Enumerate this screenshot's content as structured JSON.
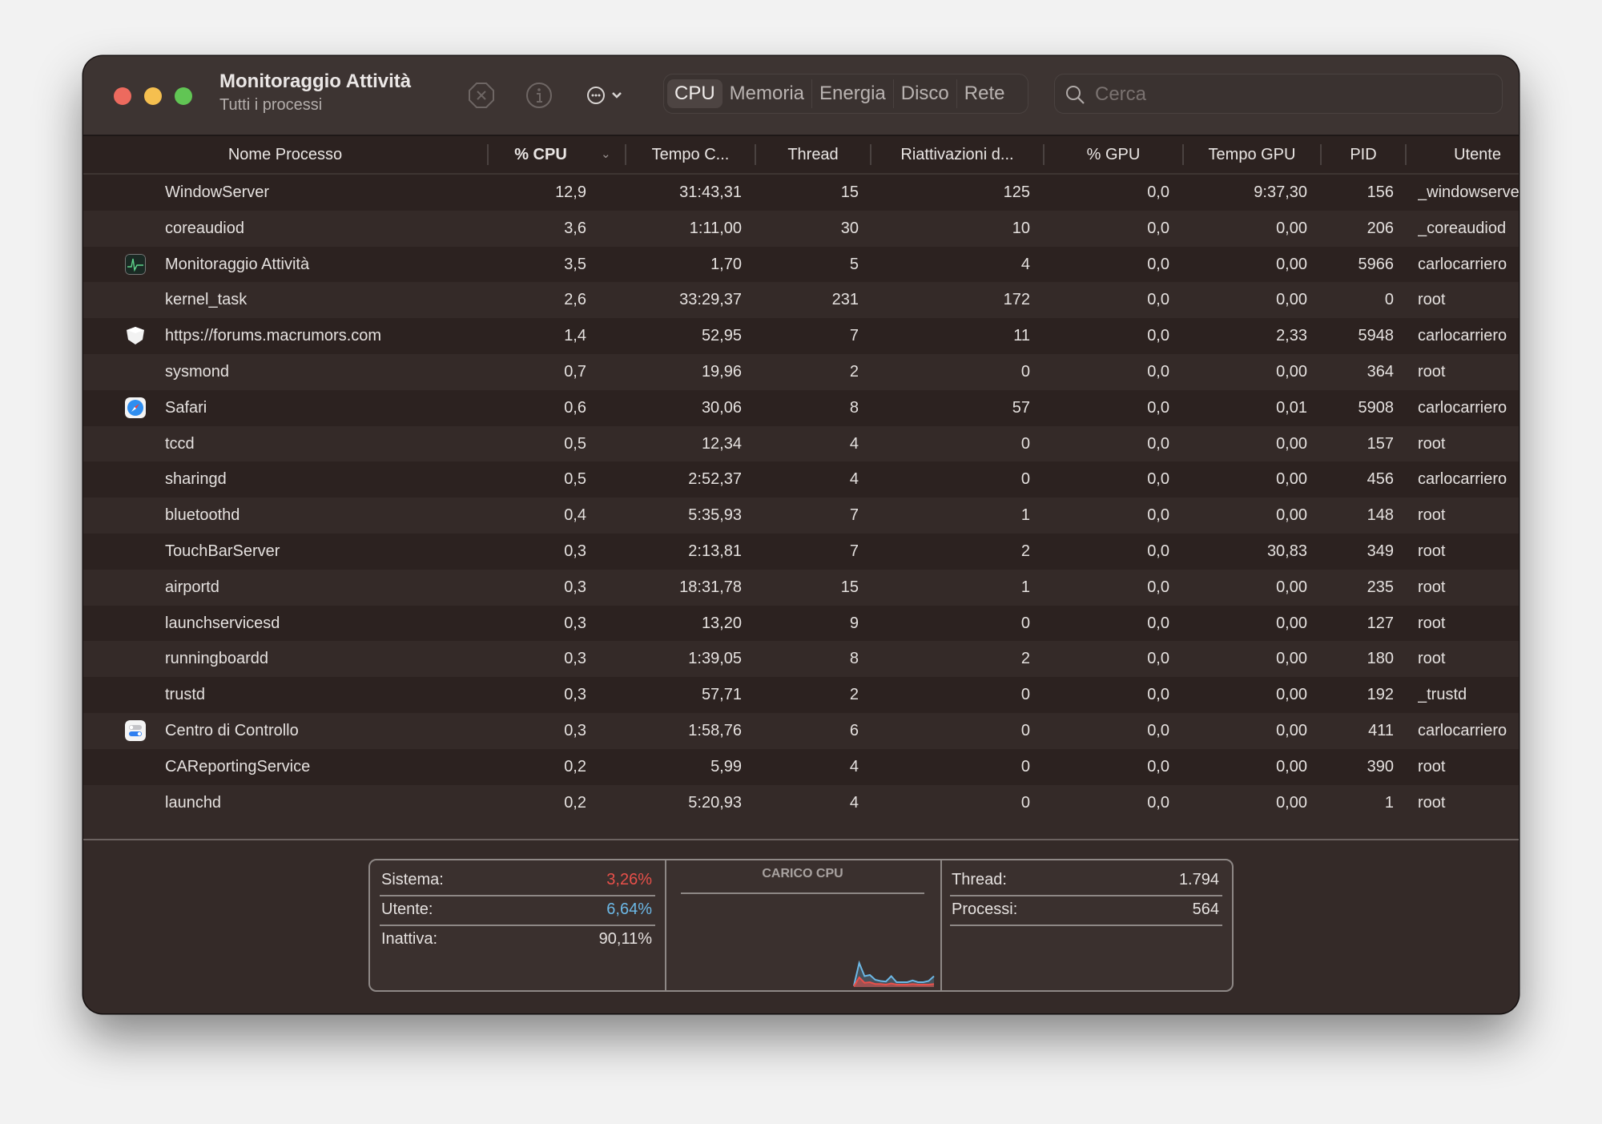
{
  "window": {
    "title": "Monitoraggio Attività",
    "subtitle": "Tutti i processi"
  },
  "toolbar": {
    "stop_icon": "stop-process-icon",
    "info_icon": "info-icon",
    "more_icon": "ellipsis-circle-icon",
    "tabs": [
      {
        "label": "CPU",
        "active": true
      },
      {
        "label": "Memoria",
        "active": false
      },
      {
        "label": "Energia",
        "active": false
      },
      {
        "label": "Disco",
        "active": false
      },
      {
        "label": "Rete",
        "active": false
      }
    ],
    "search": {
      "placeholder": "Cerca",
      "value": ""
    }
  },
  "table": {
    "columns": [
      "Nome Processo",
      "% CPU",
      "Tempo C...",
      "Thread",
      "Riattivazioni d...",
      "% GPU",
      "Tempo GPU",
      "PID",
      "Utente"
    ],
    "sorted_column": "% CPU",
    "rows": [
      {
        "icon": "",
        "name": "WindowServer",
        "cpu": "12,9",
        "cpu_time": "31:43,31",
        "threads": "15",
        "wakeups": "125",
        "gpu": "0,0",
        "gpu_time": "9:37,30",
        "pid": "156",
        "user": "_windowserver"
      },
      {
        "icon": "",
        "name": "coreaudiod",
        "cpu": "3,6",
        "cpu_time": "1:11,00",
        "threads": "30",
        "wakeups": "10",
        "gpu": "0,0",
        "gpu_time": "0,00",
        "pid": "206",
        "user": "_coreaudiod"
      },
      {
        "icon": "activity-monitor-icon",
        "name": "Monitoraggio Attività",
        "cpu": "3,5",
        "cpu_time": "1,70",
        "threads": "5",
        "wakeups": "4",
        "gpu": "0,0",
        "gpu_time": "0,00",
        "pid": "5966",
        "user": "carlocarriero"
      },
      {
        "icon": "",
        "name": "kernel_task",
        "cpu": "2,6",
        "cpu_time": "33:29,37",
        "threads": "231",
        "wakeups": "172",
        "gpu": "0,0",
        "gpu_time": "0,00",
        "pid": "0",
        "user": "root"
      },
      {
        "icon": "web-content-shield-icon",
        "name": "https://forums.macrumors.com",
        "cpu": "1,4",
        "cpu_time": "52,95",
        "threads": "7",
        "wakeups": "11",
        "gpu": "0,0",
        "gpu_time": "2,33",
        "pid": "5948",
        "user": "carlocarriero"
      },
      {
        "icon": "",
        "name": "sysmond",
        "cpu": "0,7",
        "cpu_time": "19,96",
        "threads": "2",
        "wakeups": "0",
        "gpu": "0,0",
        "gpu_time": "0,00",
        "pid": "364",
        "user": "root"
      },
      {
        "icon": "safari-icon",
        "name": "Safari",
        "cpu": "0,6",
        "cpu_time": "30,06",
        "threads": "8",
        "wakeups": "57",
        "gpu": "0,0",
        "gpu_time": "0,01",
        "pid": "5908",
        "user": "carlocarriero"
      },
      {
        "icon": "",
        "name": "tccd",
        "cpu": "0,5",
        "cpu_time": "12,34",
        "threads": "4",
        "wakeups": "0",
        "gpu": "0,0",
        "gpu_time": "0,00",
        "pid": "157",
        "user": "root"
      },
      {
        "icon": "",
        "name": "sharingd",
        "cpu": "0,5",
        "cpu_time": "2:52,37",
        "threads": "4",
        "wakeups": "0",
        "gpu": "0,0",
        "gpu_time": "0,00",
        "pid": "456",
        "user": "carlocarriero"
      },
      {
        "icon": "",
        "name": "bluetoothd",
        "cpu": "0,4",
        "cpu_time": "5:35,93",
        "threads": "7",
        "wakeups": "1",
        "gpu": "0,0",
        "gpu_time": "0,00",
        "pid": "148",
        "user": "root"
      },
      {
        "icon": "",
        "name": "TouchBarServer",
        "cpu": "0,3",
        "cpu_time": "2:13,81",
        "threads": "7",
        "wakeups": "2",
        "gpu": "0,0",
        "gpu_time": "30,83",
        "pid": "349",
        "user": "root"
      },
      {
        "icon": "",
        "name": "airportd",
        "cpu": "0,3",
        "cpu_time": "18:31,78",
        "threads": "15",
        "wakeups": "1",
        "gpu": "0,0",
        "gpu_time": "0,00",
        "pid": "235",
        "user": "root"
      },
      {
        "icon": "",
        "name": "launchservicesd",
        "cpu": "0,3",
        "cpu_time": "13,20",
        "threads": "9",
        "wakeups": "0",
        "gpu": "0,0",
        "gpu_time": "0,00",
        "pid": "127",
        "user": "root"
      },
      {
        "icon": "",
        "name": "runningboardd",
        "cpu": "0,3",
        "cpu_time": "1:39,05",
        "threads": "8",
        "wakeups": "2",
        "gpu": "0,0",
        "gpu_time": "0,00",
        "pid": "180",
        "user": "root"
      },
      {
        "icon": "",
        "name": "trustd",
        "cpu": "0,3",
        "cpu_time": "57,71",
        "threads": "2",
        "wakeups": "0",
        "gpu": "0,0",
        "gpu_time": "0,00",
        "pid": "192",
        "user": "_trustd"
      },
      {
        "icon": "control-center-icon",
        "name": "Centro di Controllo",
        "cpu": "0,3",
        "cpu_time": "1:58,76",
        "threads": "6",
        "wakeups": "0",
        "gpu": "0,0",
        "gpu_time": "0,00",
        "pid": "411",
        "user": "carlocarriero"
      },
      {
        "icon": "",
        "name": "CAReportingService",
        "cpu": "0,2",
        "cpu_time": "5,99",
        "threads": "4",
        "wakeups": "0",
        "gpu": "0,0",
        "gpu_time": "0,00",
        "pid": "390",
        "user": "root"
      },
      {
        "icon": "",
        "name": "launchd",
        "cpu": "0,2",
        "cpu_time": "5:20,93",
        "threads": "4",
        "wakeups": "0",
        "gpu": "0,0",
        "gpu_time": "0,00",
        "pid": "1",
        "user": "root"
      }
    ]
  },
  "summary": {
    "system_label": "Sistema:",
    "system_value": "3,26%",
    "user_label": "Utente:",
    "user_value": "6,64%",
    "idle_label": "Inattiva:",
    "idle_value": "90,11%",
    "chart_title": "CARICO CPU",
    "threads_label": "Thread:",
    "threads_value": "1.794",
    "processes_label": "Processi:",
    "processes_value": "564",
    "colors": {
      "system": "#e8504a",
      "user": "#6cb8e6"
    },
    "cpu_load_history": {
      "user_plus_system_pct": [
        2,
        40,
        18,
        20,
        12,
        10,
        9,
        18,
        8,
        8,
        8,
        11,
        8,
        8,
        10,
        18
      ],
      "system_pct": [
        1,
        16,
        7,
        8,
        5,
        5,
        4,
        6,
        4,
        4,
        4,
        5,
        4,
        4,
        4,
        5
      ]
    }
  }
}
